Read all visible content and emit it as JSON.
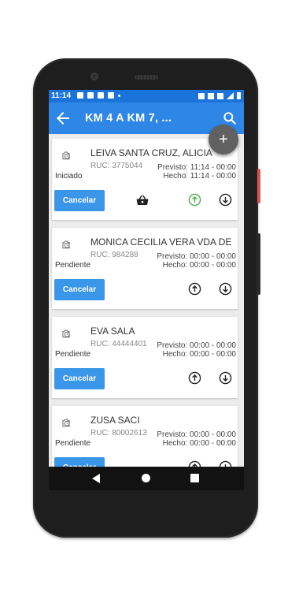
{
  "statusbar": {
    "time": "11:14"
  },
  "appbar": {
    "title": "KM 4 A KM 7, ..."
  },
  "fab_label": "+",
  "cards": [
    {
      "name": "LEIVA SANTA CRUZ, ALICIA",
      "ruc": "RUC: 3775044",
      "status": "Iniciado",
      "previsto": "Previsto: 11:14 - 00:00",
      "hecho": "Hecho: 11:14 - 00:00",
      "cancel": "Cancelar",
      "has_basket": true,
      "upload_color": "#4caf50"
    },
    {
      "name": "MONICA CECILIA VERA VDA DE",
      "ruc": "RUC: 984288",
      "status": "Pendiente",
      "previsto": "Previsto: 00:00 - 00:00",
      "hecho": "Hecho: 00:00 - 00:00",
      "cancel": "Cancelar",
      "has_basket": false,
      "upload_color": "#222222"
    },
    {
      "name": "EVA SALA",
      "ruc": "RUC: 44444401",
      "status": "Pendiente",
      "previsto": "Previsto: 00:00 - 00:00",
      "hecho": "Hecho: 00:00 - 00:00",
      "cancel": "Cancelar",
      "has_basket": false,
      "upload_color": "#222222"
    },
    {
      "name": "ZUSA SACI",
      "ruc": "RUC: 80002613",
      "status": "Pendiente",
      "previsto": "Previsto: 00:00 - 00:00",
      "hecho": "Hecho: 00:00 - 00:00",
      "cancel": "Cancelar",
      "has_basket": false,
      "upload_color": "#222222"
    }
  ],
  "icons": {
    "back": "arrow-left-icon",
    "search": "search-icon",
    "clock": "clock-icon",
    "basket": "basket-icon",
    "upload": "arrow-up-circle-icon",
    "download": "arrow-down-circle-icon"
  },
  "colors": {
    "statusbar": "#1a73d9",
    "appbar": "#2e86e6",
    "cancel_button": "#3a96e8",
    "fab": "#616161"
  }
}
